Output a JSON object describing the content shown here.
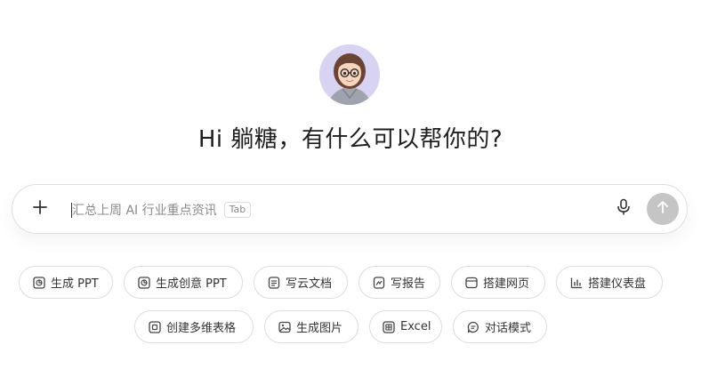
{
  "greeting": "Hi 躺糖，有什么可以帮你的?",
  "composer": {
    "placeholder": "汇总上周 AI 行业重点资讯",
    "tab_hint": "Tab"
  },
  "quick_actions_row1": [
    {
      "label": "生成 PPT",
      "icon": "ppt-icon"
    },
    {
      "label": "生成创意 PPT",
      "icon": "creative-ppt-icon"
    },
    {
      "label": "写云文档",
      "icon": "document-icon"
    },
    {
      "label": "写报告",
      "icon": "report-icon"
    },
    {
      "label": "搭建网页",
      "icon": "webpage-icon"
    },
    {
      "label": "搭建仪表盘",
      "icon": "dashboard-icon"
    }
  ],
  "quick_actions_row2": [
    {
      "label": "创建多维表格",
      "icon": "table-icon"
    },
    {
      "label": "生成图片",
      "icon": "image-icon"
    },
    {
      "label": "Excel",
      "icon": "excel-icon"
    },
    {
      "label": "对话模式",
      "icon": "chat-icon"
    }
  ],
  "colors": {
    "send_button_disabled": "#c5c5c5",
    "avatar_bg": "#d9d3f3",
    "border": "#dadde3"
  }
}
